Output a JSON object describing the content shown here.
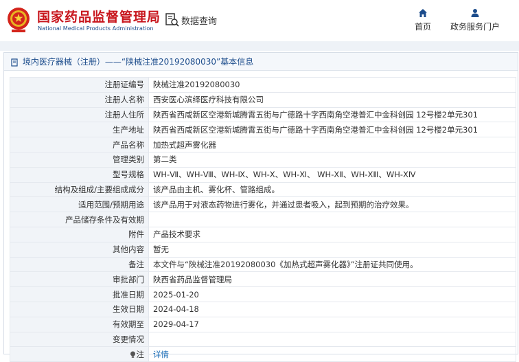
{
  "header": {
    "agency_cn": "国家药品监督管理局",
    "agency_en": "National Medical Products Administration",
    "search_label": "数据查询",
    "nav": [
      {
        "label": "首页",
        "icon": "home-icon"
      },
      {
        "label": "政务服务门户",
        "icon": "user-icon"
      }
    ]
  },
  "panel": {
    "title": "境内医疗器械（注册）——“陕械注准20192080030”基本信息"
  },
  "rows": [
    {
      "label": "注册证编号",
      "value": "陕械注准20192080030"
    },
    {
      "label": "注册人名称",
      "value": "西安医心滨绎医疗科技有限公司"
    },
    {
      "label": "注册人住所",
      "value": "陕西省西咸新区空港新城腾霄五街与广德路十字西南角空港普汇中金科创园 12号楼2单元301"
    },
    {
      "label": "生产地址",
      "value": "陕西省西咸新区空港新城腾霄五街与广德路十字西南角空港普汇中金科创园 12号楼2单元301"
    },
    {
      "label": "产品名称",
      "value": "加热式超声雾化器"
    },
    {
      "label": "管理类别",
      "value": "第二类"
    },
    {
      "label": "型号规格",
      "value": "WH-Ⅶ、WH-Ⅷ、WH-Ⅸ、WH-Ⅹ、WH-Ⅺ、 WH-ⅩⅡ、WH-ⅩⅢ、WH-ⅩⅣ"
    },
    {
      "label": "结构及组成/主要组成成分",
      "value": "该产品由主机、雾化杯、管路组成。"
    },
    {
      "label": "适用范围/预期用途",
      "value": "该产品用于对液态药物进行雾化，并通过患者吸入，起到预期的治疗效果。"
    },
    {
      "label": "产品储存条件及有效期",
      "value": ""
    },
    {
      "label": "附件",
      "value": "产品技术要求"
    },
    {
      "label": "其他内容",
      "value": "暂无"
    },
    {
      "label": "备注",
      "value": "本文件与“陕械注准20192080030《加热式超声雾化器》”注册证共同使用。"
    },
    {
      "label": "审批部门",
      "value": "陕西省药品监督管理局"
    },
    {
      "label": "批准日期",
      "value": "2025-01-20"
    },
    {
      "label": "生效日期",
      "value": "2024-04-18"
    },
    {
      "label": "有效期至",
      "value": "2029-04-17"
    },
    {
      "label": "变更情况",
      "value": ""
    }
  ],
  "note_row": {
    "label": "注",
    "link": "详情",
    "icon": "lightbulb-icon"
  },
  "colors": {
    "brand_red": "#c8161d",
    "brand_blue": "#1d4d8c",
    "link": "#1d6fb8"
  }
}
